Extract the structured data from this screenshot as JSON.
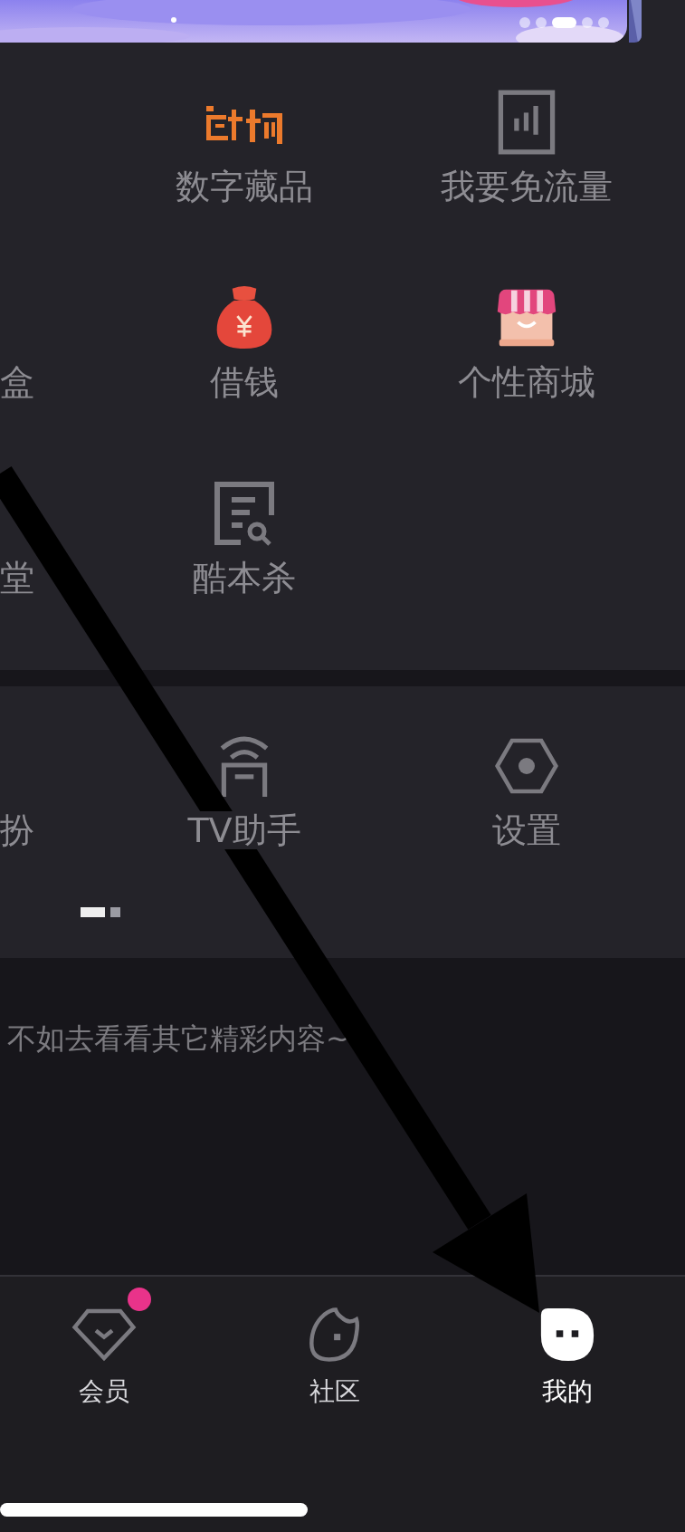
{
  "banner": {
    "kind": "picture",
    "pages": [
      {
        "selected": false
      },
      {
        "selected": false
      },
      {
        "selected": true
      },
      {
        "selected": false
      },
      {
        "selected": false
      }
    ]
  },
  "services": [
    {
      "label": "数字藏品"
    },
    {
      "label": "我要免流量"
    },
    {
      "label": "盒"
    },
    {
      "label": "借钱"
    },
    {
      "label": "个性商城"
    },
    {
      "label": "堂"
    },
    {
      "label": "酷本杀"
    }
  ],
  "tools": {
    "items": [
      {
        "label": "扮"
      },
      {
        "label": "TV助手"
      },
      {
        "label": "设置"
      }
    ],
    "pages": [
      {
        "selected": true
      },
      {
        "selected": false
      }
    ]
  },
  "empty_hint": "不如去看看其它精彩内容~",
  "tab_bar": [
    {
      "label": "会员",
      "selected": false,
      "badge": true
    },
    {
      "label": "社区",
      "selected": false,
      "badge": false
    },
    {
      "label": "我的",
      "selected": true,
      "badge": false
    }
  ]
}
